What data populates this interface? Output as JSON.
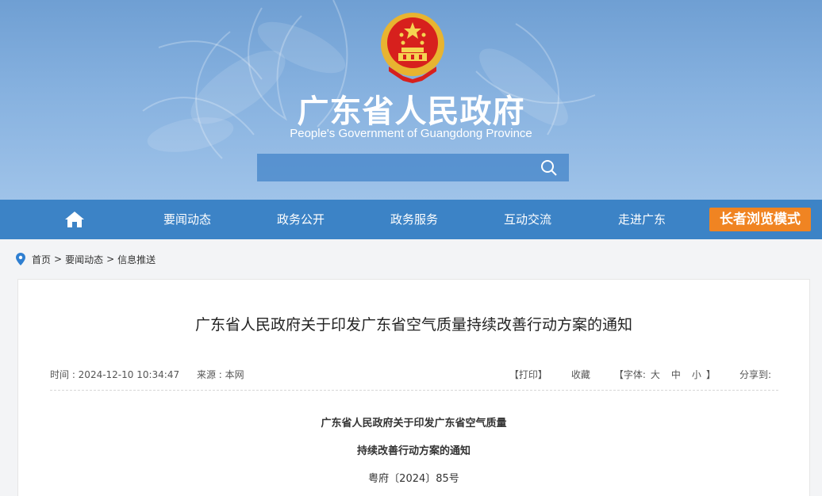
{
  "header": {
    "site_title": "广东省人民政府",
    "site_subtitle": "People's Government of Guangdong Province",
    "search": {
      "placeholder": "",
      "value": ""
    }
  },
  "nav": {
    "items": [
      "要闻动态",
      "政务公开",
      "政务服务",
      "互动交流",
      "走进广东"
    ],
    "elder_mode": "长者浏览模式"
  },
  "breadcrumb": [
    "首页",
    "要闻动态",
    "信息推送"
  ],
  "article": {
    "title": "广东省人民政府关于印发广东省空气质量持续改善行动方案的通知",
    "time_label": "时间 : 2024-12-10 10:34:47",
    "source_label": "来源 : 本网",
    "print": "【打印】",
    "favorite": "收藏",
    "font_open": "【字体:",
    "font_large": "大",
    "font_medium": "中",
    "font_small": "小",
    "font_close": "】",
    "share": "分享到:",
    "doc_title_line1": "广东省人民政府关于印发广东省空气质量",
    "doc_title_line2": "持续改善行动方案的通知",
    "doc_number": "粤府〔2024〕85号"
  },
  "colors": {
    "nav_bg": "#3c83c6",
    "elder_btn": "#f08422",
    "banner_top": "#6f9fd3"
  },
  "icons": [
    "national-emblem-icon",
    "search-icon",
    "home-icon",
    "location-pin-icon"
  ]
}
